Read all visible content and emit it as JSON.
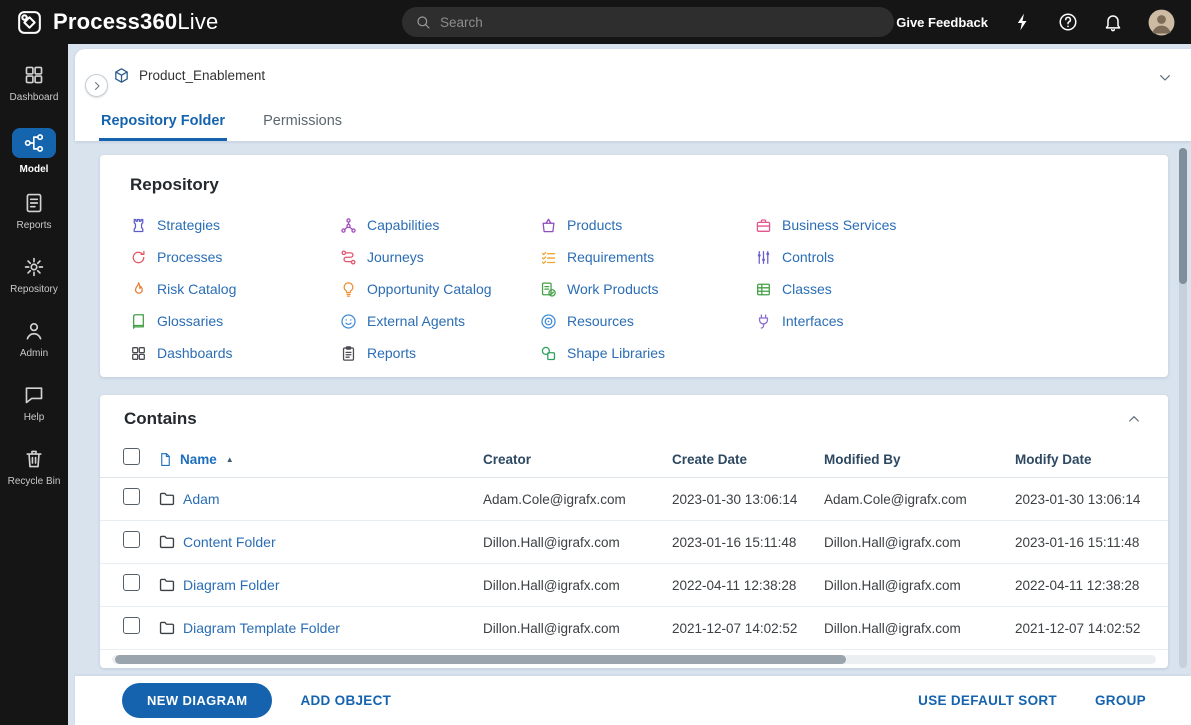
{
  "header": {
    "logo_bold": "Process360",
    "logo_light": "Live",
    "search_placeholder": "Search",
    "give_feedback": "Give Feedback"
  },
  "sidebar": {
    "items": [
      {
        "label": "Dashboard",
        "icon": "dashboard",
        "active": false
      },
      {
        "label": "Model",
        "icon": "model",
        "active": true
      },
      {
        "label": "Reports",
        "icon": "reports",
        "active": false
      },
      {
        "label": "Repository",
        "icon": "repository",
        "active": false
      },
      {
        "label": "Admin",
        "icon": "admin",
        "active": false
      },
      {
        "label": "Help",
        "icon": "help",
        "active": false
      },
      {
        "label": "Recycle Bin",
        "icon": "recycle-bin",
        "active": false
      }
    ]
  },
  "page": {
    "breadcrumb": "Product_Enablement",
    "tabs": [
      {
        "label": "Repository Folder",
        "active": true
      },
      {
        "label": "Permissions",
        "active": false
      }
    ]
  },
  "repository": {
    "title": "Repository",
    "links": [
      {
        "label": "Strategies",
        "icon": "strategies",
        "color": "#5b5fc7"
      },
      {
        "label": "Processes",
        "icon": "processes",
        "color": "#e25763"
      },
      {
        "label": "Risk Catalog",
        "icon": "risk-catalog",
        "color": "#e87d33"
      },
      {
        "label": "Glossaries",
        "icon": "glossaries",
        "color": "#43a047"
      },
      {
        "label": "Dashboards",
        "icon": "dashboards",
        "color": "#4a4a52"
      },
      {
        "label": "Capabilities",
        "icon": "capabilities",
        "color": "#a14dbf"
      },
      {
        "label": "Journeys",
        "icon": "journeys",
        "color": "#e2556e"
      },
      {
        "label": "Opportunity Catalog",
        "icon": "opportunity-catalog",
        "color": "#ef8f2f"
      },
      {
        "label": "External Agents",
        "icon": "external-agents",
        "color": "#3f8cd6"
      },
      {
        "label": "Reports",
        "icon": "report-clipboard",
        "color": "#4a4a52"
      },
      {
        "label": "Products",
        "icon": "products",
        "color": "#8f4dbf"
      },
      {
        "label": "Requirements",
        "icon": "requirements",
        "color": "#efa22f"
      },
      {
        "label": "Work Products",
        "icon": "work-products",
        "color": "#43a047"
      },
      {
        "label": "Resources",
        "icon": "resources",
        "color": "#3f8cd6"
      },
      {
        "label": "Shape Libraries",
        "icon": "shape-libraries",
        "color": "#2fa05f"
      },
      {
        "label": "Business Services",
        "icon": "business-services",
        "color": "#e2558e"
      },
      {
        "label": "Controls",
        "icon": "controls",
        "color": "#6a5fd0"
      },
      {
        "label": "Classes",
        "icon": "classes",
        "color": "#43a047"
      },
      {
        "label": "Interfaces",
        "icon": "interfaces",
        "color": "#8f6cd0"
      }
    ]
  },
  "contains": {
    "title": "Contains",
    "columns": [
      "Name",
      "Creator",
      "Create Date",
      "Modified By",
      "Modify Date"
    ],
    "sort": {
      "column": "Name",
      "direction": "asc"
    },
    "rows": [
      {
        "name": "Adam",
        "creator": "Adam.Cole@igrafx.com",
        "create_date": "2023-01-30 13:06:14",
        "modified_by": "Adam.Cole@igrafx.com",
        "modify_date": "2023-01-30 13:06:14"
      },
      {
        "name": "Content Folder",
        "creator": "Dillon.Hall@igrafx.com",
        "create_date": "2023-01-16 15:11:48",
        "modified_by": "Dillon.Hall@igrafx.com",
        "modify_date": "2023-01-16 15:11:48"
      },
      {
        "name": "Diagram Folder",
        "creator": "Dillon.Hall@igrafx.com",
        "create_date": "2022-04-11 12:38:28",
        "modified_by": "Dillon.Hall@igrafx.com",
        "modify_date": "2022-04-11 12:38:28"
      },
      {
        "name": "Diagram Template Folder",
        "creator": "Dillon.Hall@igrafx.com",
        "create_date": "2021-12-07 14:02:52",
        "modified_by": "Dillon.Hall@igrafx.com",
        "modify_date": "2021-12-07 14:02:52"
      }
    ]
  },
  "footer": {
    "new_diagram": "NEW DIAGRAM",
    "add_object": "ADD OBJECT",
    "use_default_sort": "USE DEFAULT SORT",
    "group": "GROUP"
  },
  "colors": {
    "accent": "#1563ae",
    "topbar": "#151515",
    "content_bg": "#d8e3ee",
    "link": "#2a6db5"
  }
}
